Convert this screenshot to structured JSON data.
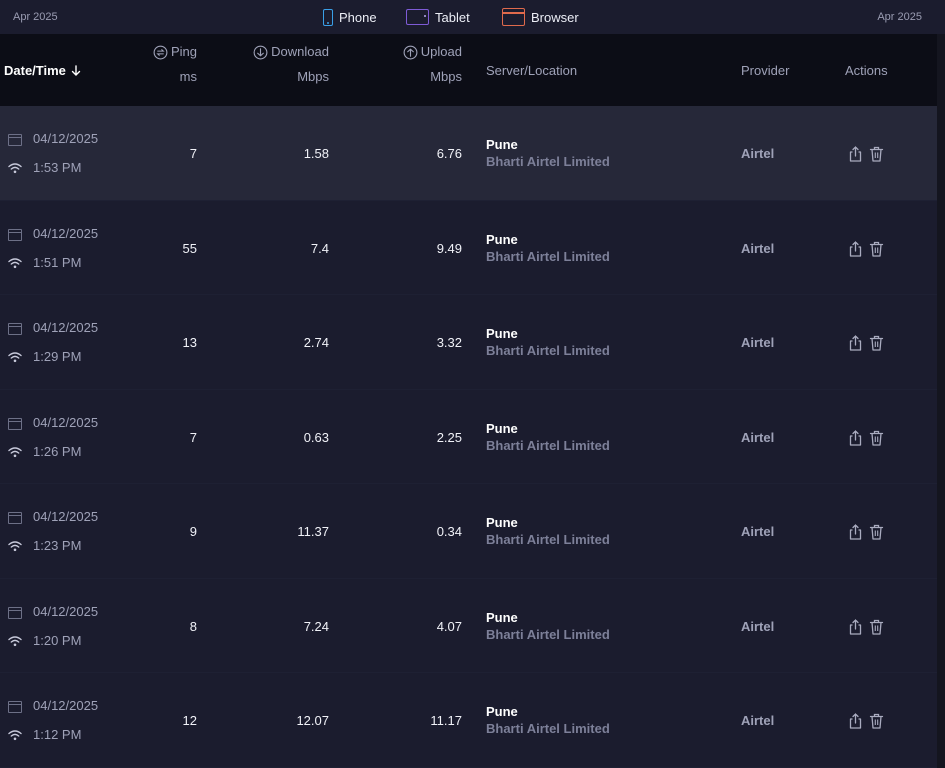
{
  "topbar": {
    "date_left": "Apr 2025",
    "date_right": "Apr 2025",
    "legend": [
      {
        "label": "Phone",
        "icon": "phone-icon",
        "color": "#3aa0e8"
      },
      {
        "label": "Tablet",
        "icon": "tablet-icon",
        "color": "#7e5bd6"
      },
      {
        "label": "Browser",
        "icon": "browser-icon",
        "color": "#e06a4c"
      }
    ]
  },
  "table": {
    "headers": {
      "datetime": "Date/Time",
      "ping": "Ping",
      "ping_unit": "ms",
      "download": "Download",
      "download_unit": "Mbps",
      "upload": "Upload",
      "upload_unit": "Mbps",
      "server": "Server/Location",
      "provider": "Provider",
      "actions": "Actions"
    },
    "rows": [
      {
        "date": "04/12/2025",
        "time": "1:53 PM",
        "ping": "7",
        "download": "1.58",
        "upload": "6.76",
        "city": "Pune",
        "isp": "Bharti Airtel Limited",
        "provider": "Airtel"
      },
      {
        "date": "04/12/2025",
        "time": "1:51 PM",
        "ping": "55",
        "download": "7.4",
        "upload": "9.49",
        "city": "Pune",
        "isp": "Bharti Airtel Limited",
        "provider": "Airtel"
      },
      {
        "date": "04/12/2025",
        "time": "1:29 PM",
        "ping": "13",
        "download": "2.74",
        "upload": "3.32",
        "city": "Pune",
        "isp": "Bharti Airtel Limited",
        "provider": "Airtel"
      },
      {
        "date": "04/12/2025",
        "time": "1:26 PM",
        "ping": "7",
        "download": "0.63",
        "upload": "2.25",
        "city": "Pune",
        "isp": "Bharti Airtel Limited",
        "provider": "Airtel"
      },
      {
        "date": "04/12/2025",
        "time": "1:23 PM",
        "ping": "9",
        "download": "11.37",
        "upload": "0.34",
        "city": "Pune",
        "isp": "Bharti Airtel Limited",
        "provider": "Airtel"
      },
      {
        "date": "04/12/2025",
        "time": "1:20 PM",
        "ping": "8",
        "download": "7.24",
        "upload": "4.07",
        "city": "Pune",
        "isp": "Bharti Airtel Limited",
        "provider": "Airtel"
      },
      {
        "date": "04/12/2025",
        "time": "1:12 PM",
        "ping": "12",
        "download": "12.07",
        "upload": "11.17",
        "city": "Pune",
        "isp": "Bharti Airtel Limited",
        "provider": "Airtel"
      }
    ]
  }
}
